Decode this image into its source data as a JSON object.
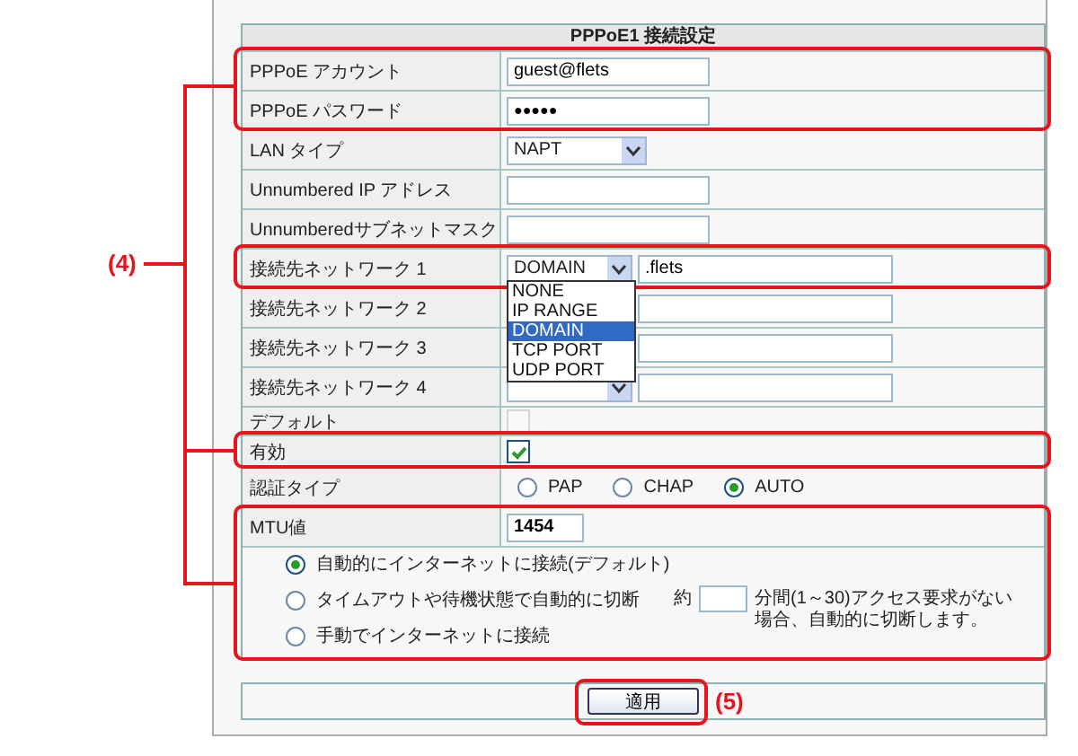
{
  "section_title": "PPPoE1 接続設定",
  "rows": [
    {
      "kind": "text",
      "label": "PPPoE アカウント",
      "value": "guest@flets"
    },
    {
      "kind": "password",
      "label": "PPPoE パスワード",
      "value": "●●●●●"
    },
    {
      "kind": "select",
      "label": "LAN タイプ",
      "value": "NAPT"
    },
    {
      "kind": "text",
      "label": "Unnumbered IP アドレス"
    },
    {
      "kind": "text",
      "label": "Unnumberedサブネットマスク"
    },
    {
      "kind": "network",
      "label": "接続先ネットワーク 1",
      "value": "DOMAIN",
      "text": ".flets",
      "dropdown": [
        {
          "label": "NONE",
          "selected": false
        },
        {
          "label": "IP RANGE",
          "selected": false
        },
        {
          "label": "DOMAIN",
          "selected": true
        },
        {
          "label": "TCP PORT",
          "selected": false
        },
        {
          "label": "UDP PORT",
          "selected": false
        }
      ]
    },
    {
      "kind": "network",
      "label": "接続先ネットワーク 2"
    },
    {
      "kind": "network",
      "label": "接続先ネットワーク 3"
    },
    {
      "kind": "network",
      "label": "接続先ネットワーク 4"
    },
    {
      "kind": "checkbox",
      "label": "デフォルト",
      "checked": false,
      "disabled": true
    },
    {
      "kind": "checkbox",
      "label": "有効",
      "checked": true,
      "disabled": false
    },
    {
      "kind": "radios",
      "label": "認証タイプ",
      "options": [
        {
          "label": "PAP",
          "selected": false
        },
        {
          "label": "CHAP",
          "selected": false
        },
        {
          "label": "AUTO",
          "selected": true
        }
      ]
    },
    {
      "kind": "short",
      "label": "MTU値",
      "value": "1454"
    }
  ],
  "connect_modes": [
    {
      "label": "自動的にインターネットに接続(デフォルト)",
      "selected": true
    },
    {
      "label": "タイムアウトや待機状態で自動的に切断",
      "selected": false,
      "timeout": {
        "prefix": "約",
        "suffix": "分間(1～30)アクセス要求がない場合、自動的に切断します。"
      }
    },
    {
      "label": "手動でインターネットに接続",
      "selected": false
    }
  ],
  "apply_button": "適用",
  "callouts": [
    "(4)",
    "(5)"
  ]
}
